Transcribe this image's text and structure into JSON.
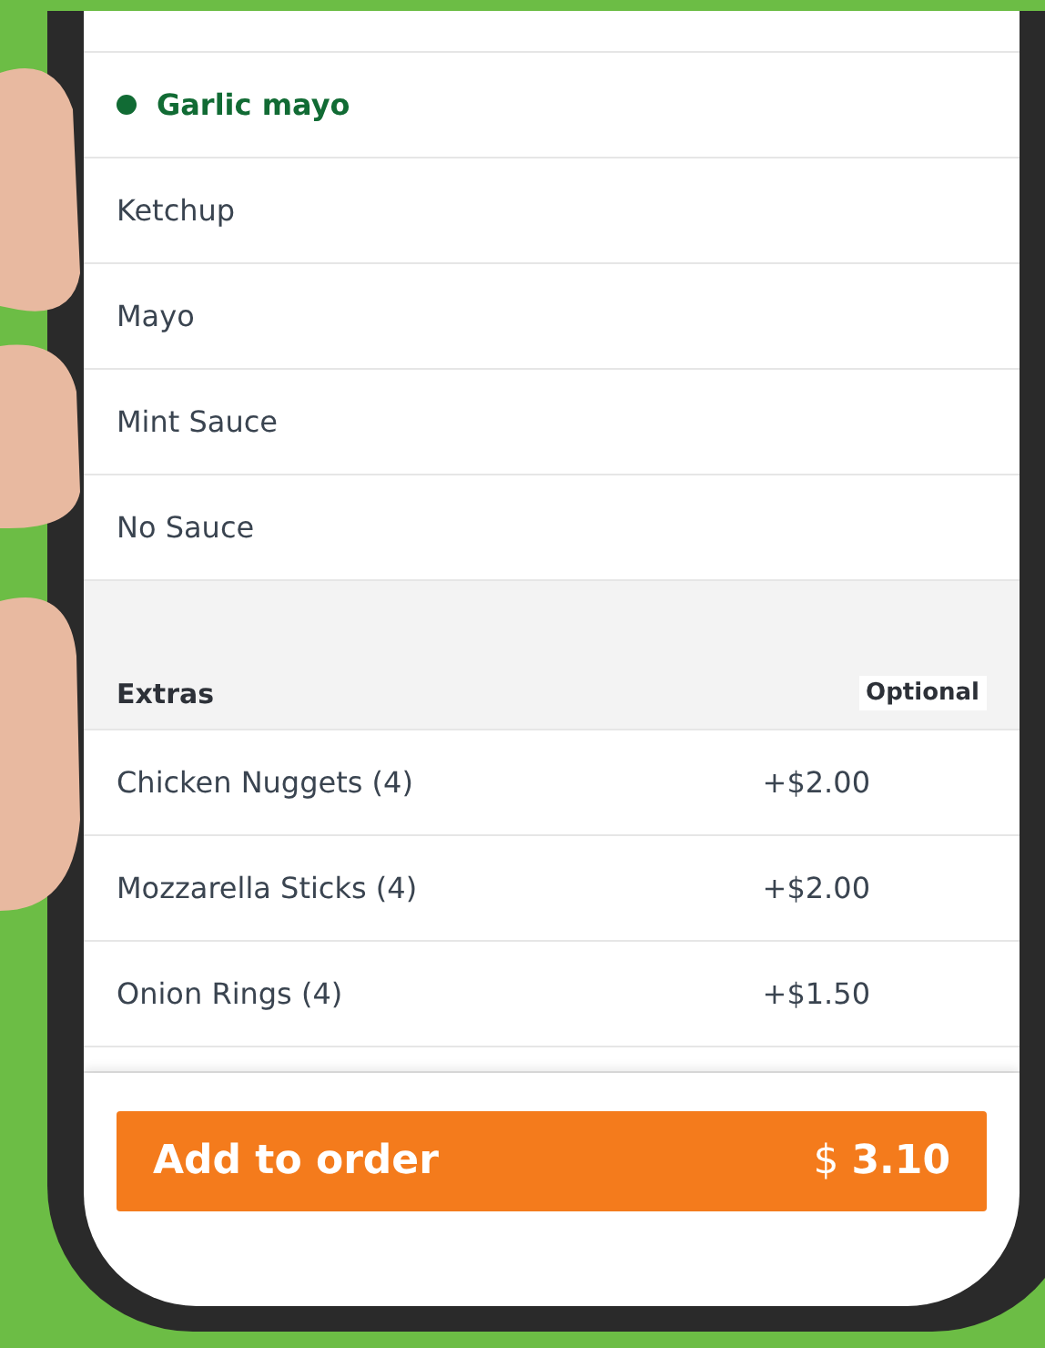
{
  "sauces": [
    {
      "label": "Garlic mayo",
      "selected": true
    },
    {
      "label": "Ketchup",
      "selected": false
    },
    {
      "label": "Mayo",
      "selected": false
    },
    {
      "label": "Mint Sauce",
      "selected": false
    },
    {
      "label": "No Sauce",
      "selected": false
    }
  ],
  "extras": {
    "title": "Extras",
    "badge": "Optional",
    "items": [
      {
        "label": "Chicken Nuggets (4)",
        "price": "+$2.00"
      },
      {
        "label": "Mozzarella Sticks (4)",
        "price": "+$2.00"
      },
      {
        "label": "Onion Rings (4)",
        "price": "+$1.50"
      }
    ]
  },
  "add_button": {
    "label": "Add to order",
    "total": "$ **3.10**"
  }
}
